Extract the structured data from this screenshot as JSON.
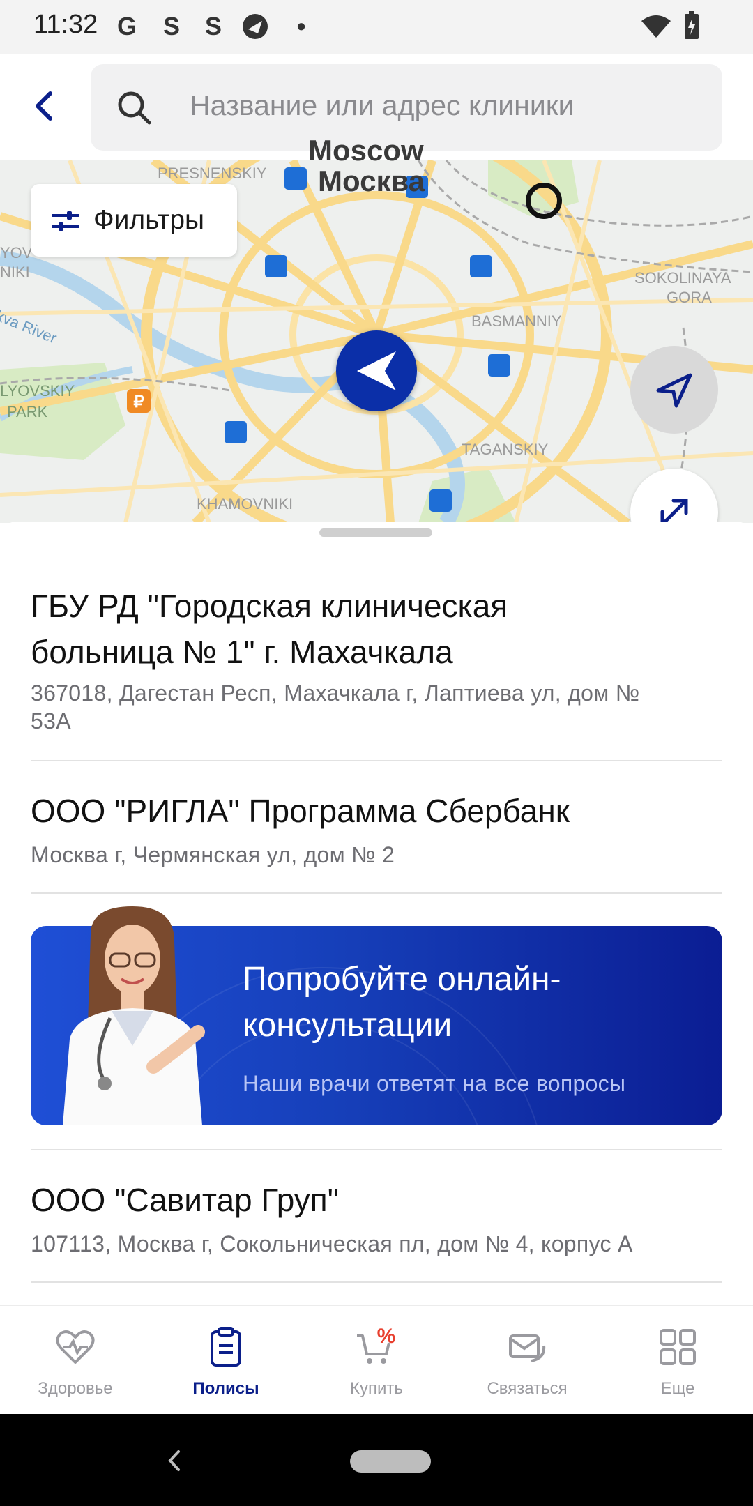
{
  "status_bar": {
    "time": "11:32",
    "icons": [
      "google-icon",
      "s-app-icon",
      "s-app-icon",
      "browser-icon",
      "dot-icon",
      "wifi-icon",
      "battery-charging-icon"
    ]
  },
  "search": {
    "placeholder": "Название или адрес клиники"
  },
  "map": {
    "filters_label": "Фильтры",
    "labels": {
      "city_en": "Moscow",
      "city_ru_partial": "Москва",
      "presnensky": "PRESNENSKIY",
      "basmanny": "BASMANNIY",
      "taganskiy": "TAGANSKIY",
      "khamovniki": "KHAMOVNIKI",
      "sokolinaya_1": "SOKOLINAYA",
      "sokolinaya_2": "GORA",
      "river": "kva River",
      "park_1": "LYOVSKIY",
      "park_2": "PARK",
      "left_top_1": "YOV",
      "left_top_2": "NIKI"
    }
  },
  "clinics": [
    {
      "name_line1": "ГБУ РД \"Городская клиническая",
      "name_line2": "больница № 1\" г. Махачкала",
      "address_line1": "367018, Дагестан Респ, Махачкала г, Лаптиева ул, дом №",
      "address_line2": "53А"
    },
    {
      "name": "ООО \"РИГЛА\" Программа Сбербанк",
      "address": "Москва г, Чермянская ул, дом № 2"
    },
    {
      "name": "ООО \"Савитар Груп\"",
      "address": "107113, Москва г, Сокольническая пл, дом № 4, корпус А"
    }
  ],
  "promo": {
    "title_line1": "Попробуйте онлайн-",
    "title_line2": "консультации",
    "subtitle": "Наши врачи ответят на все вопросы"
  },
  "bottom_nav": [
    {
      "label": "Здоровье",
      "icon": "heart-pulse-icon",
      "active": false
    },
    {
      "label": "Полисы",
      "icon": "clipboard-icon",
      "active": true
    },
    {
      "label": "Купить",
      "icon": "cart-percent-icon",
      "active": false
    },
    {
      "label": "Связаться",
      "icon": "chat-mail-icon",
      "active": false
    },
    {
      "label": "Еще",
      "icon": "grid-icon",
      "active": false
    }
  ],
  "colors": {
    "brand": "#0b1f8a",
    "promo_gradient_start": "#1f4fd6",
    "promo_gradient_end": "#0b1d93",
    "accent_red": "#e8402f"
  }
}
